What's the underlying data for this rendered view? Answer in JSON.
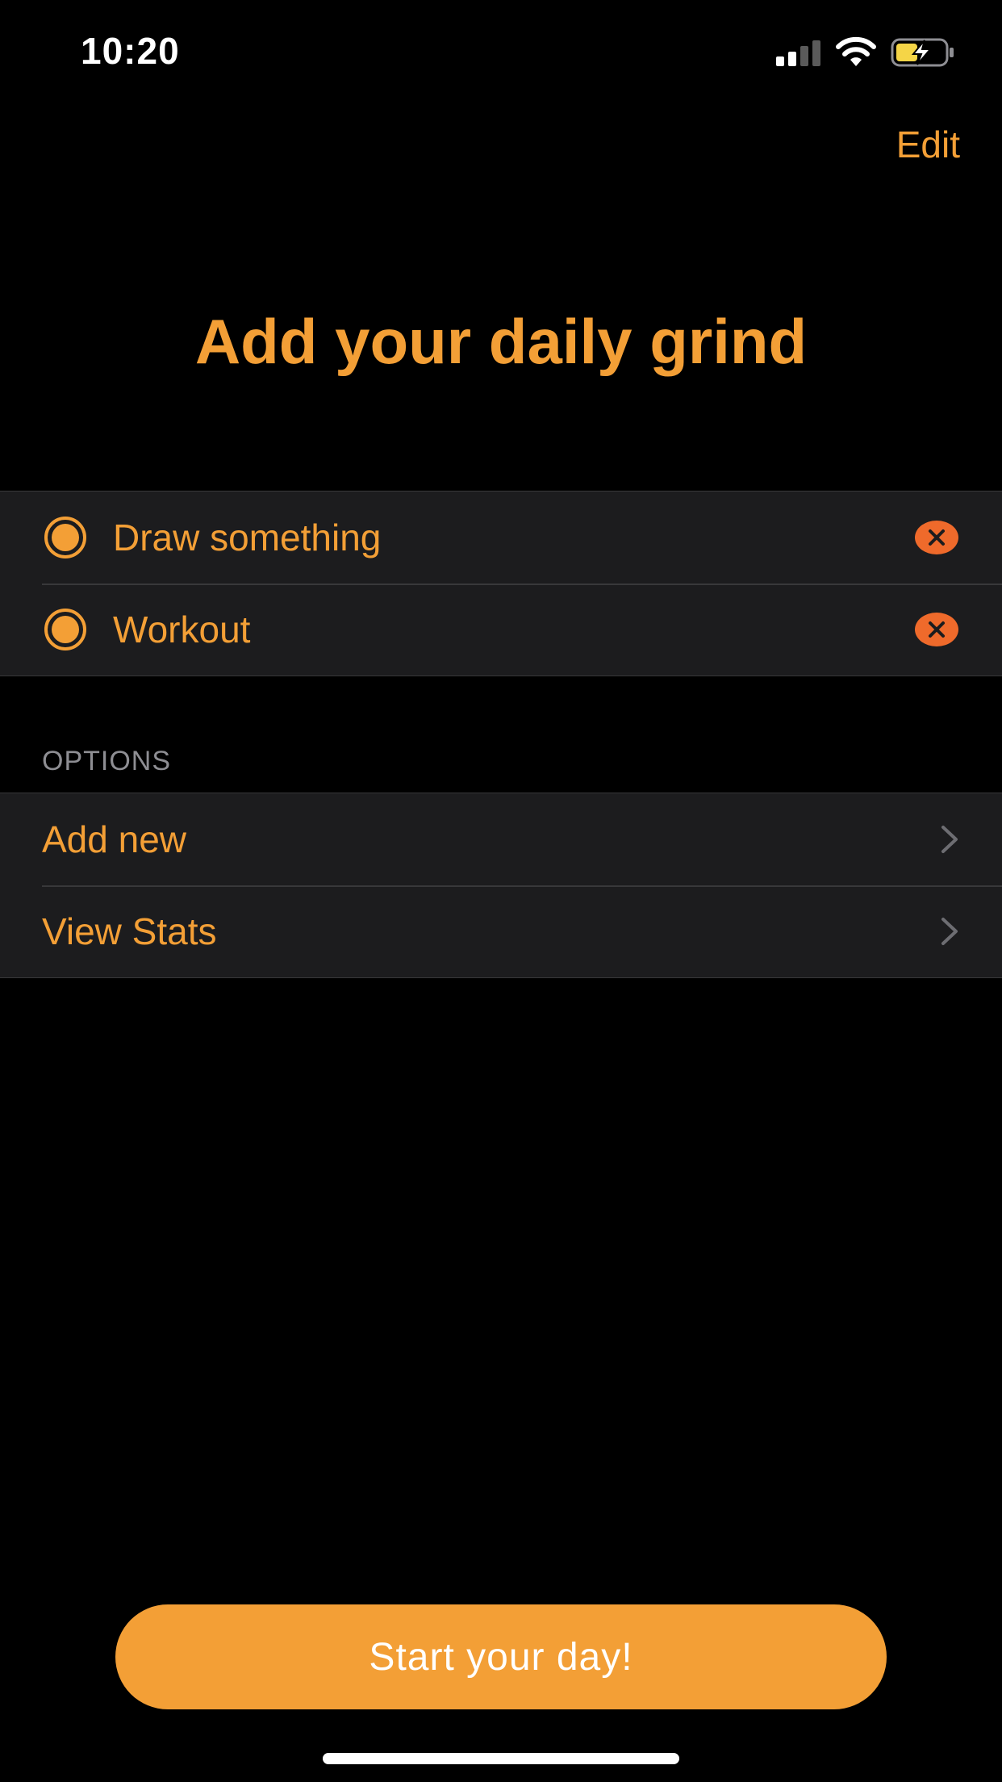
{
  "status_bar": {
    "time": "10:20",
    "icons": [
      "cellular-signal-icon",
      "wifi-icon",
      "battery-charging-icon"
    ]
  },
  "nav": {
    "edit_label": "Edit"
  },
  "title": "Add your daily grind",
  "tasks": [
    {
      "label": "Draw something",
      "icon": "radio-circle-icon",
      "action_icon": "delete-icon"
    },
    {
      "label": "Workout",
      "icon": "radio-circle-icon",
      "action_icon": "delete-icon"
    }
  ],
  "options": {
    "header": "OPTIONS",
    "items": [
      {
        "label": "Add new",
        "icon": "chevron-right-icon"
      },
      {
        "label": "View Stats",
        "icon": "chevron-right-icon"
      }
    ]
  },
  "start_button": {
    "label": "Start your day!"
  },
  "colors": {
    "accent": "#f39f36",
    "delete": "#ef6a2b",
    "background": "#000000",
    "cell": "#1c1c1e",
    "secondary_text": "#8e8e93",
    "battery_fill": "#f5d547"
  }
}
